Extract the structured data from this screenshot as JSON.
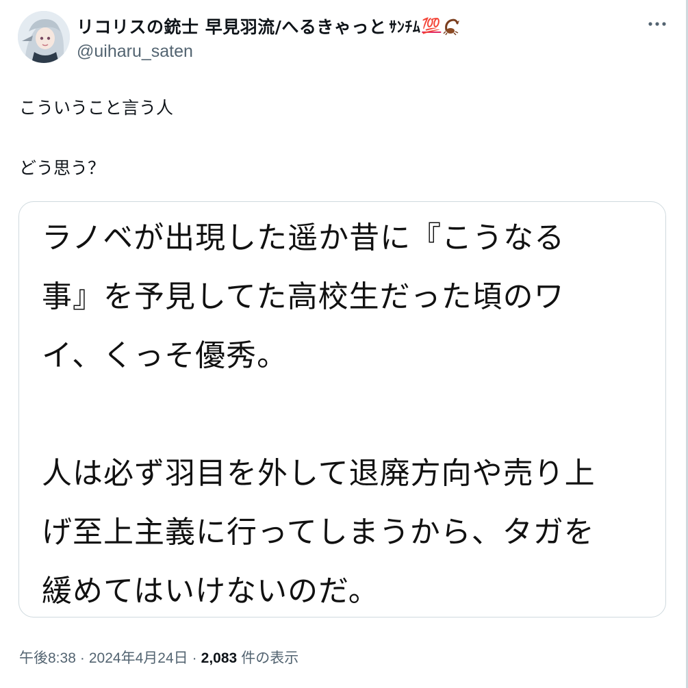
{
  "author": {
    "display_name": "リコリスの銃士 早見羽流/へるきゃっと",
    "name_emoji_text": "ｻﾝﾁﾑ",
    "name_emoji_100": "💯",
    "name_emoji_scorpion": "scorpion-icon",
    "handle": "@uiharu_saten"
  },
  "more_icon": "more-horizontal-icon",
  "tweet": {
    "text": "こういうこと言う人\n\nどう思う？"
  },
  "quote": {
    "text": "ラノベが出現した遥か昔に『こうなる\n事』を予見してた高校生だった頃のワ\nイ、くっそ優秀。\n\n人は必ず羽目を外して退廃方向や売り上\nげ至上主義に行ってしまうから、タガを\n緩めてはいけないのだ。"
  },
  "meta": {
    "time": "午後8:38",
    "separator": "·",
    "date": "2024年4月24日",
    "views_count": "2,083",
    "views_label": "件の表示"
  },
  "colors": {
    "text": "#0f1419",
    "secondary": "#536471",
    "border": "#cfd9de"
  }
}
